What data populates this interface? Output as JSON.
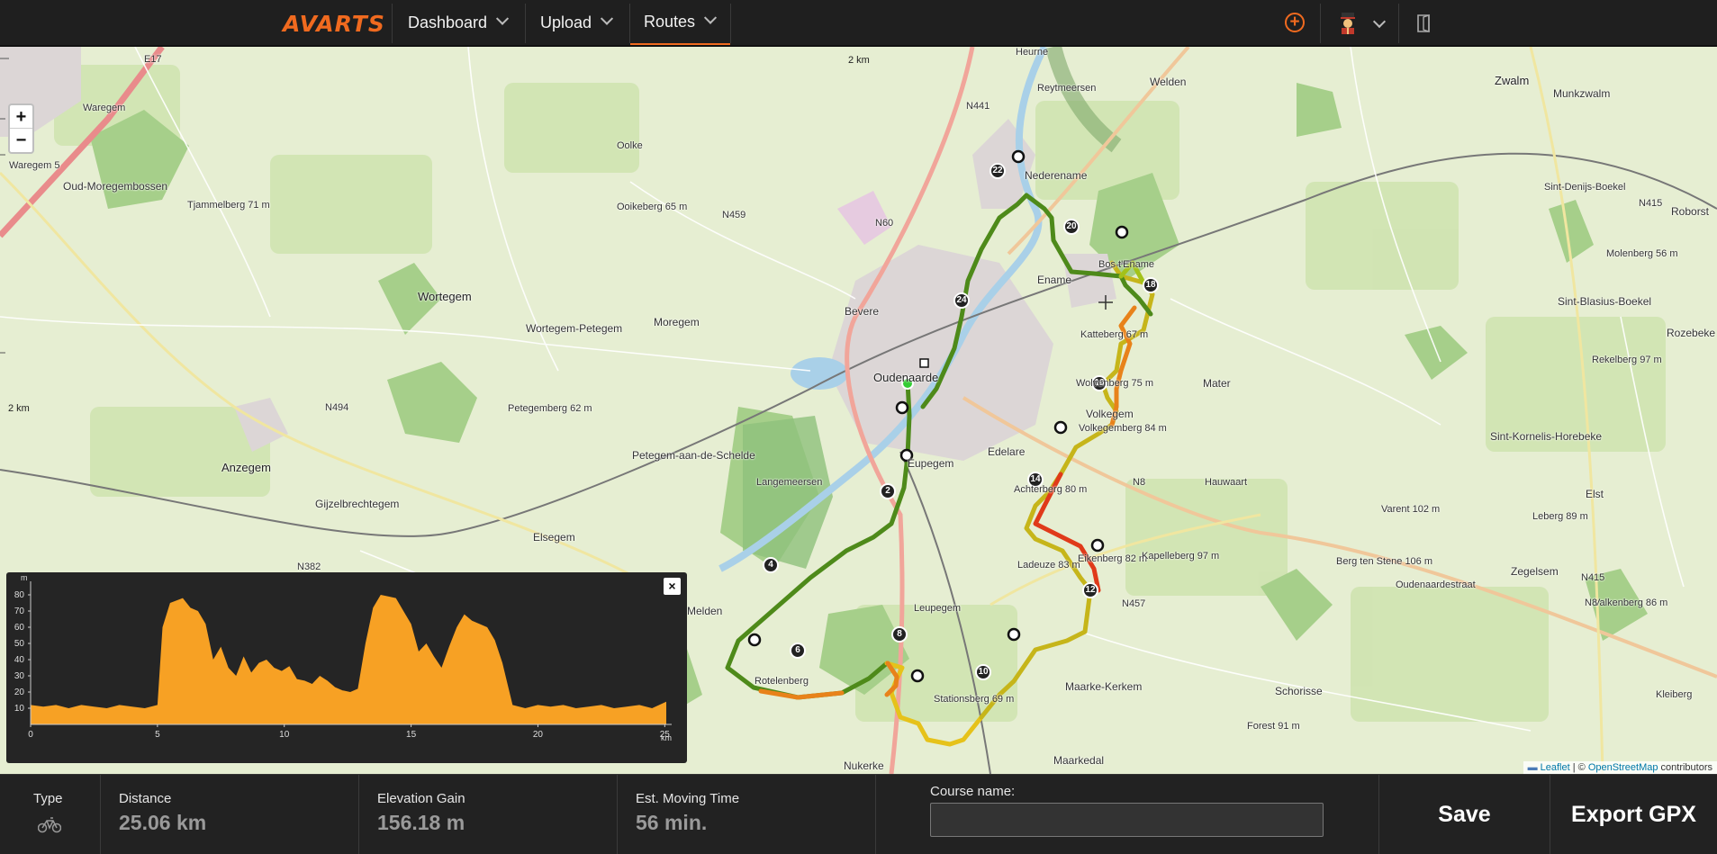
{
  "app": {
    "logo": "AVARTS"
  },
  "nav": {
    "dashboard": "Dashboard",
    "upload": "Upload",
    "routes": "Routes"
  },
  "map": {
    "zoom_in": "+",
    "zoom_out": "−",
    "scale_top": "2 km",
    "scale_left": "2 km",
    "attribution_leaflet": "Leaflet",
    "attribution_sep": " | © ",
    "attribution_osm": "OpenStreetMap",
    "attribution_tail": " contributors",
    "labels": [
      {
        "t": "E17"
      },
      {
        "t": "Waregem"
      },
      {
        "t": "Waregem 5"
      },
      {
        "t": "Oud-Moregembossen"
      },
      {
        "t": "Tjammelberg 71 m"
      },
      {
        "t": "Oolke"
      },
      {
        "t": "Ooikeberg 65 m"
      },
      {
        "t": "N459"
      },
      {
        "t": "N60"
      },
      {
        "t": "N441"
      },
      {
        "t": "Heurne"
      },
      {
        "t": "Welden"
      },
      {
        "t": "Reytmeersen"
      },
      {
        "t": "Zwalm"
      },
      {
        "t": "Munkzwalm"
      },
      {
        "t": "Nederename"
      },
      {
        "t": "Sint-Denijs-Boekel"
      },
      {
        "t": "N415"
      },
      {
        "t": "Roborst"
      },
      {
        "t": "Molenberg 56 m"
      },
      {
        "t": "Wortegem"
      },
      {
        "t": "Wortegem-Petegem"
      },
      {
        "t": "Moregem"
      },
      {
        "t": "Bevere"
      },
      {
        "t": "Ename"
      },
      {
        "t": "Bos t'Ename"
      },
      {
        "t": "Sint-Blasius-Boekel"
      },
      {
        "t": "Rozebeke"
      },
      {
        "t": "Rekelberg 97 m"
      },
      {
        "t": "Oudenaarde"
      },
      {
        "t": "Katteberg 67 m"
      },
      {
        "t": "Mater"
      },
      {
        "t": "N494"
      },
      {
        "t": "Wolvenberg 75 m"
      },
      {
        "t": "Volkegem"
      },
      {
        "t": "Volkegemberg 84 m"
      },
      {
        "t": "Petegemberg 62 m"
      },
      {
        "t": "Anzegem"
      },
      {
        "t": "Petegem-aan-de-Schelde"
      },
      {
        "t": "Eupegem"
      },
      {
        "t": "Edelare"
      },
      {
        "t": "Langemeersen"
      },
      {
        "t": "Sint-Kornelis-Horebeke"
      },
      {
        "t": "N8"
      },
      {
        "t": "Hauwaart"
      },
      {
        "t": "Achterberg 80 m"
      },
      {
        "t": "Gijzelbrechtegem"
      },
      {
        "t": "Elsegem"
      },
      {
        "t": "Varent 102 m"
      },
      {
        "t": "Leberg 89 m"
      },
      {
        "t": "Elst"
      },
      {
        "t": "N382"
      },
      {
        "t": "Eikenberg 82 m"
      },
      {
        "t": "Kapelleberg 97 m"
      },
      {
        "t": "Ladeuze 83 m"
      },
      {
        "t": "Zegelsem"
      },
      {
        "t": "Melden"
      },
      {
        "t": "N457"
      },
      {
        "t": "Berg ten Stene 106 m"
      },
      {
        "t": "N415"
      },
      {
        "t": "Leupegem"
      },
      {
        "t": "Rotelenberg"
      },
      {
        "t": "Valkenberg 86 m"
      },
      {
        "t": "Maarke-Kerkem"
      },
      {
        "t": "Schorisse"
      },
      {
        "t": "Stationsberg 69 m"
      },
      {
        "t": "Forest 91 m"
      },
      {
        "t": "Nukerke"
      },
      {
        "t": "Maarkedal"
      },
      {
        "t": "Oudenaardestraat"
      },
      {
        "t": "N8"
      },
      {
        "t": "Kleiberg"
      }
    ],
    "markers": [
      "2",
      "4",
      "6",
      "8",
      "10",
      "12",
      "14",
      "16",
      "18",
      "20",
      "22",
      "24"
    ]
  },
  "elevation": {
    "unit": "m",
    "y_ticks": [
      "80",
      "70",
      "60",
      "50",
      "40",
      "30",
      "20",
      "10"
    ],
    "x_ticks": [
      "0",
      "5",
      "10",
      "15",
      "20",
      "25"
    ],
    "x_unit": "km",
    "close": "×"
  },
  "chart_data": {
    "type": "area",
    "title": "",
    "xlabel": "km",
    "ylabel": "m",
    "xlim": [
      0,
      25.06
    ],
    "ylim": [
      0,
      85
    ],
    "x": [
      0,
      0.5,
      1,
      1.5,
      2,
      2.5,
      3,
      3.5,
      4,
      4.5,
      5,
      5.2,
      5.5,
      6,
      6.3,
      6.6,
      6.9,
      7.2,
      7.5,
      7.8,
      8.1,
      8.4,
      8.7,
      9,
      9.3,
      9.6,
      9.9,
      10.2,
      10.5,
      10.8,
      11.1,
      11.4,
      11.7,
      12,
      12.3,
      12.6,
      12.9,
      13.2,
      13.5,
      13.8,
      14.1,
      14.4,
      14.7,
      15,
      15.3,
      15.6,
      15.9,
      16.2,
      16.5,
      16.8,
      17.1,
      17.4,
      17.7,
      18,
      18.3,
      18.6,
      19,
      19.5,
      20,
      20.5,
      21,
      21.5,
      22,
      22.5,
      23,
      23.5,
      24,
      24.5,
      25.06
    ],
    "y": [
      12,
      11,
      12,
      10,
      12,
      11,
      10,
      12,
      11,
      10,
      12,
      60,
      75,
      78,
      72,
      70,
      62,
      40,
      48,
      35,
      30,
      42,
      32,
      38,
      40,
      35,
      33,
      36,
      28,
      27,
      25,
      30,
      27,
      23,
      21,
      20,
      22,
      50,
      72,
      80,
      79,
      78,
      70,
      62,
      45,
      50,
      42,
      35,
      48,
      60,
      68,
      64,
      62,
      60,
      52,
      38,
      12,
      10,
      12,
      11,
      12,
      10,
      11,
      12,
      10,
      11,
      12,
      10,
      14
    ]
  },
  "stats": {
    "type_label": "Type",
    "distance_label": "Distance",
    "distance_value": "25.06 km",
    "elev_label": "Elevation Gain",
    "elev_value": "156.18 m",
    "time_label": "Est. Moving Time",
    "time_value": "56 min."
  },
  "course": {
    "label": "Course name:",
    "placeholder": "",
    "value": ""
  },
  "actions": {
    "save": "Save",
    "export": "Export GPX"
  },
  "colors": {
    "accent": "#f06a1f",
    "elevation_fill": "#f7a124",
    "route_green": "#4e8a1a",
    "route_red": "#e03a1a",
    "route_yellow": "#e6c21a"
  }
}
